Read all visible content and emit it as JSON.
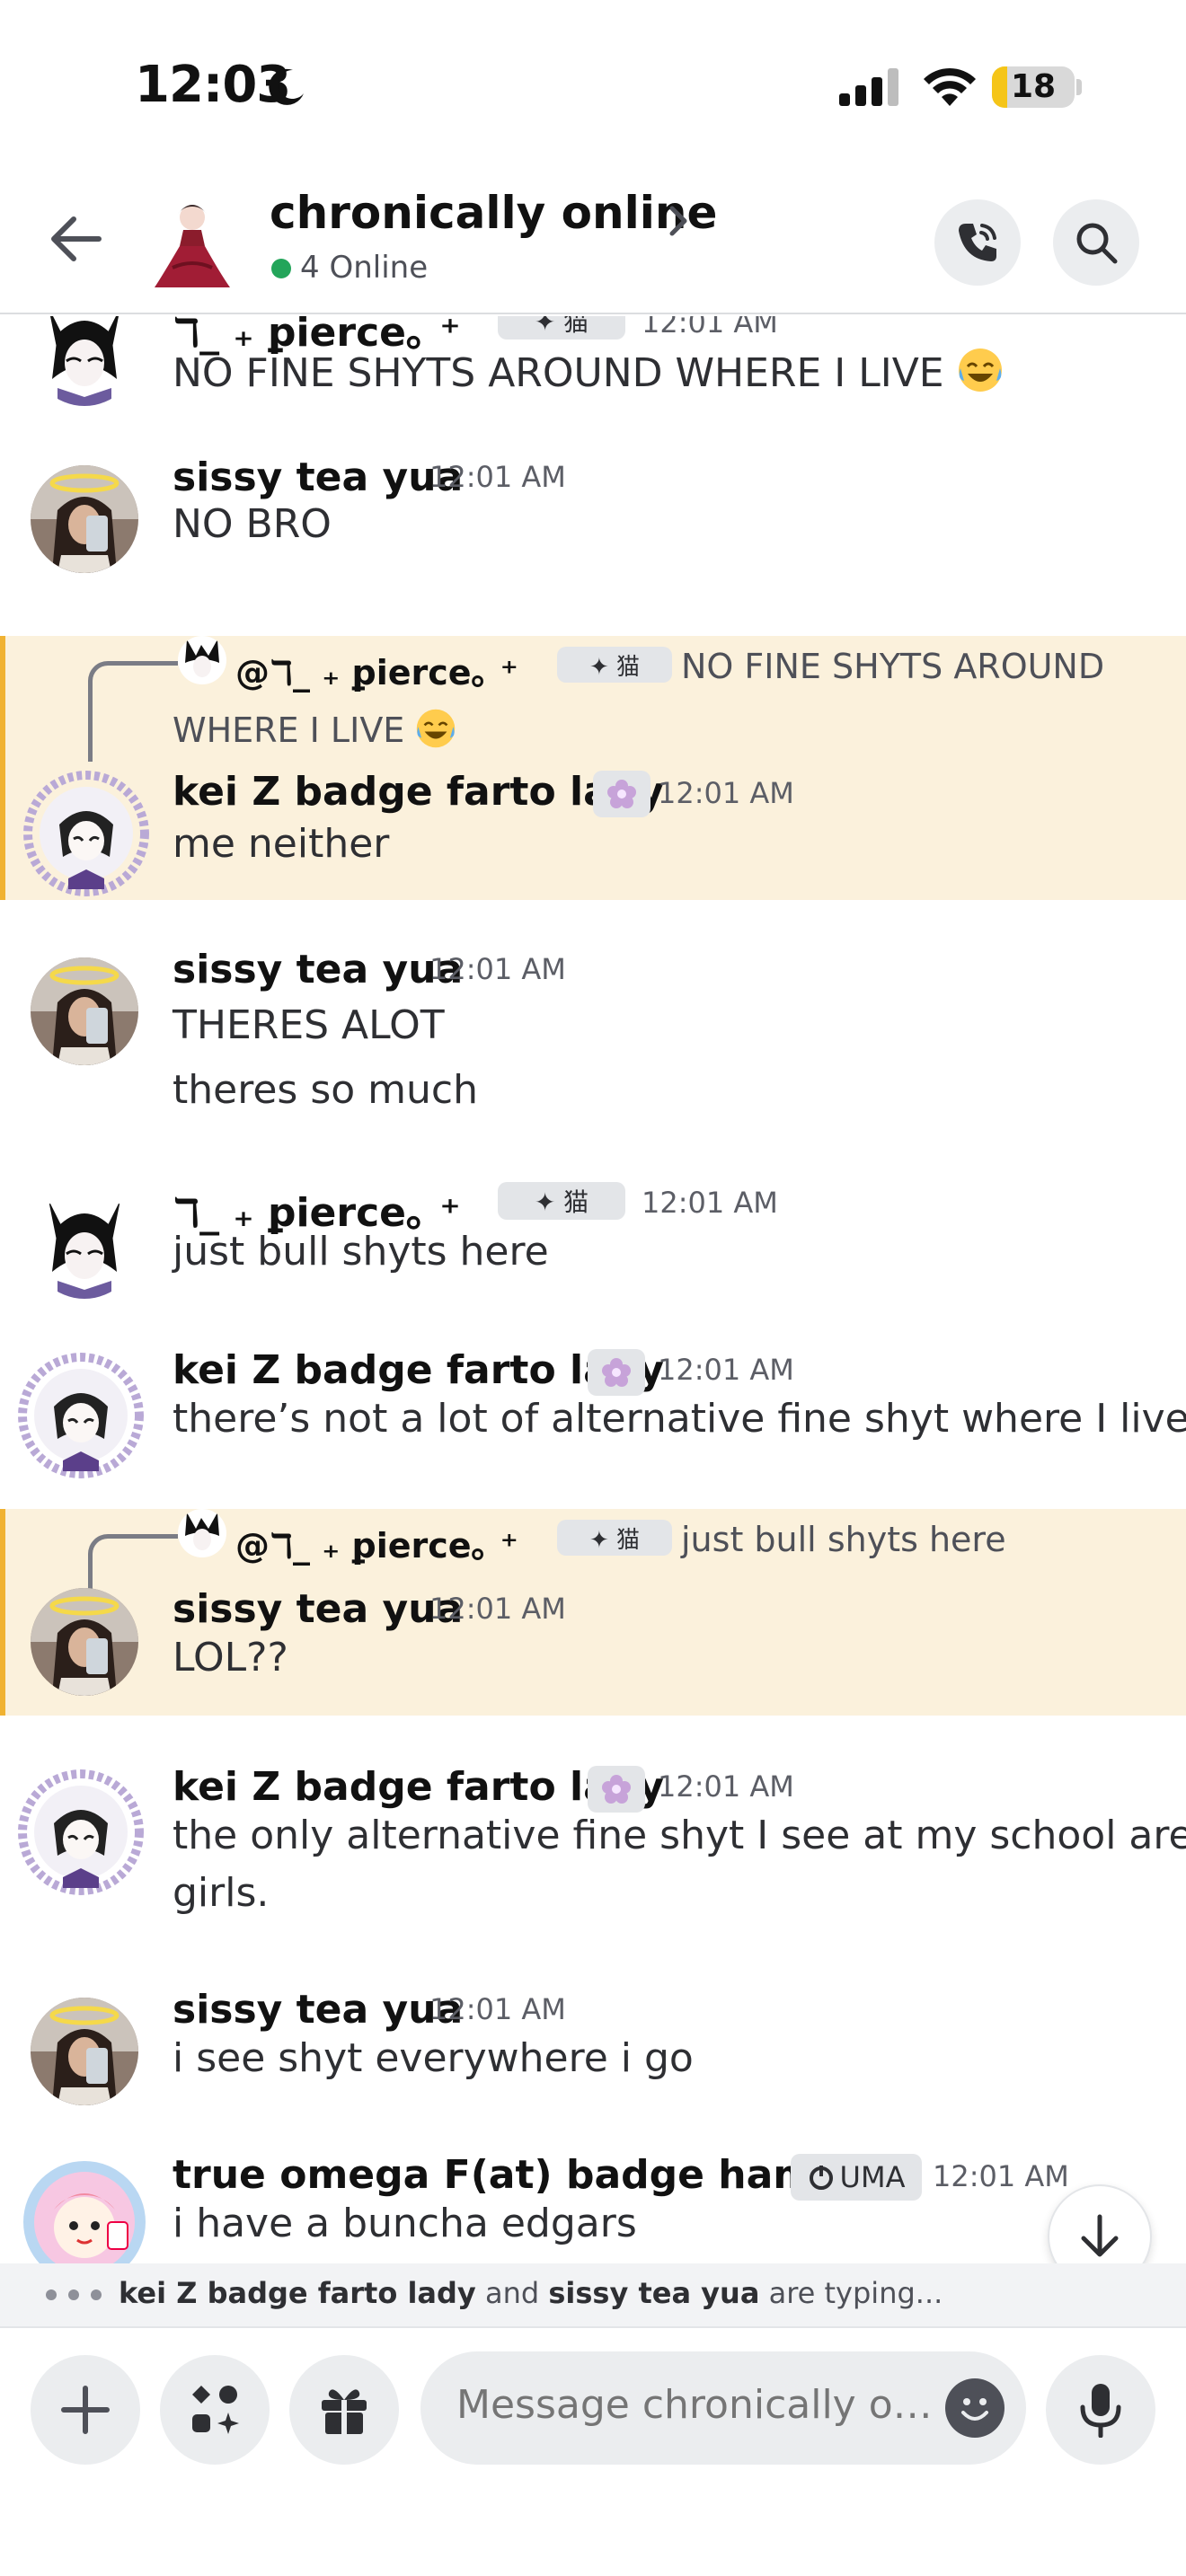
{
  "status_bar": {
    "time": "12:03",
    "battery": "18",
    "battery_level": 0.18
  },
  "header": {
    "channel_name": "chronically online",
    "online": "4 Online"
  },
  "messages": [
    {
      "user": "ℸ_ ₊ ꝑierce｡ ⁺",
      "badge": "✦ 猫",
      "time": "12:01 AM",
      "lines": [
        "NO FINE SHYTS AROUND WHERE I LIVE"
      ]
    },
    {
      "user": "sissy tea yua",
      "time": "12:01 AM",
      "lines": [
        "NO BRO"
      ]
    },
    {
      "reply_user": "@ℸ_ ₊ ꝑierce｡ ⁺",
      "reply_badge": "✦ 猫",
      "reply_text_1": "NO FINE SHYTS AROUND",
      "reply_text_2": "WHERE I LIVE",
      "user": "kei Z badge farto lady",
      "time": "12:01 AM",
      "lines": [
        "me neither"
      ]
    },
    {
      "user": "sissy tea yua",
      "time": "12:01 AM",
      "lines": [
        "THERES ALOT",
        "theres so much"
      ]
    },
    {
      "user": "ℸ_ ₊ ꝑierce｡ ⁺",
      "badge": "✦ 猫",
      "time": "12:01 AM",
      "lines": [
        "just bull shyts here"
      ]
    },
    {
      "user": "kei Z badge farto lady",
      "time": "12:01 AM",
      "lines": [
        "there’s not a lot of alternative fine shyt where I live."
      ]
    },
    {
      "reply_user": "@ℸ_ ₊ ꝑierce｡ ⁺",
      "reply_badge": "✦ 猫",
      "reply_text_1": "just bull shyts here",
      "user": "sissy tea yua",
      "time": "12:01 AM",
      "lines": [
        "LOL??"
      ]
    },
    {
      "user": "kei Z badge farto lady",
      "time": "12:01 AM",
      "lines": [
        "the only alternative fine shyt I see at my school are",
        "girls."
      ]
    },
    {
      "user": "sissy tea yua",
      "time": "12:01 AM",
      "lines": [
        "i see shyt everywhere i go"
      ]
    },
    {
      "user": "true omega F(at) badge hampter",
      "badge": "UMA",
      "time": "12:01 AM",
      "lines": [
        "i have a buncha edgars"
      ]
    }
  ],
  "typing": {
    "user1": "kei Z badge farto lady",
    "and": "and",
    "user2": "sissy tea yua",
    "suffix": "are typing..."
  },
  "composer": {
    "placeholder": "Message chronically onli.."
  },
  "colors": {
    "highlight_bg": "#fbf1dc",
    "highlight_bar": "#f0b232",
    "online": "#23a55a",
    "battery": "#f5c518"
  },
  "icons": [
    "moon-icon",
    "signal-icon",
    "wifi-icon",
    "back-arrow-icon",
    "chevron-right-icon",
    "phone-icon",
    "search-icon",
    "arrow-down-icon",
    "plus-icon",
    "apps-icon",
    "gift-icon",
    "emoji-icon",
    "microphone-icon",
    "laugh-cry-emoji"
  ]
}
